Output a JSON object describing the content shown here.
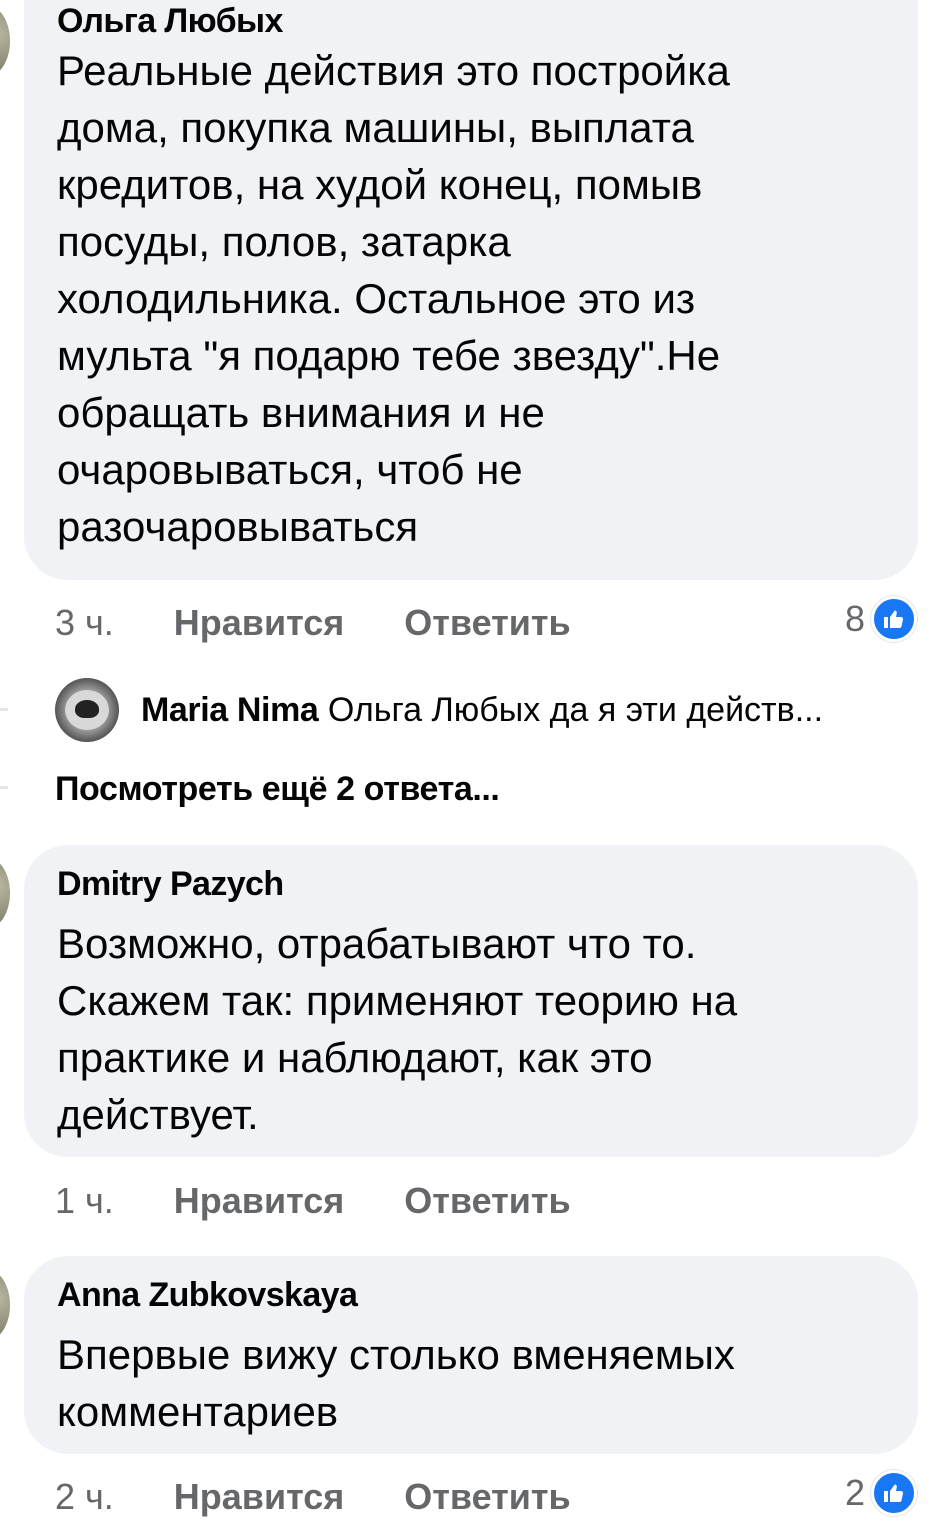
{
  "comments": [
    {
      "author": "Ольга Любых",
      "text": "Реальные действия это постройка\nдома, покупка машины, выплата\nкредитов, на худой конец, помыв\nпосуды, полов, затарка\nхолодильника. Остальное это из\nмульта \"я подарю тебе звезду\".Не\nобращать внимания и не\nочаровываться, чтоб не\nразочаровываться",
      "time": "3 ч.",
      "like_label": "Нравится",
      "reply_label": "Ответить",
      "reactions": "8",
      "reaction_icon": "thumbs-up-icon"
    },
    {
      "author": "Dmitry Pazych",
      "text": "Возможно, отрабатывают что то.\nСкажем так: применяют теорию на\nпрактике и наблюдают, как это\nдействует.",
      "time": "1 ч.",
      "like_label": "Нравится",
      "reply_label": "Ответить"
    },
    {
      "author": "Anna Zubkovskaya",
      "text": "Впервые вижу столько вменяемых\nкомментариев",
      "time": "2 ч.",
      "like_label": "Нравится",
      "reply_label": "Ответить",
      "reactions": "2",
      "reaction_icon": "thumbs-up-icon"
    }
  ],
  "reply_preview": {
    "author": "Maria Nima",
    "snippet": "Ольга Любых да я эти действ..."
  },
  "more_replies_label": "Посмотреть ещё 2 ответа...",
  "colors": {
    "bubble": "#f0f2f5",
    "meta": "#65676b",
    "like_blue": "#1877f2"
  }
}
